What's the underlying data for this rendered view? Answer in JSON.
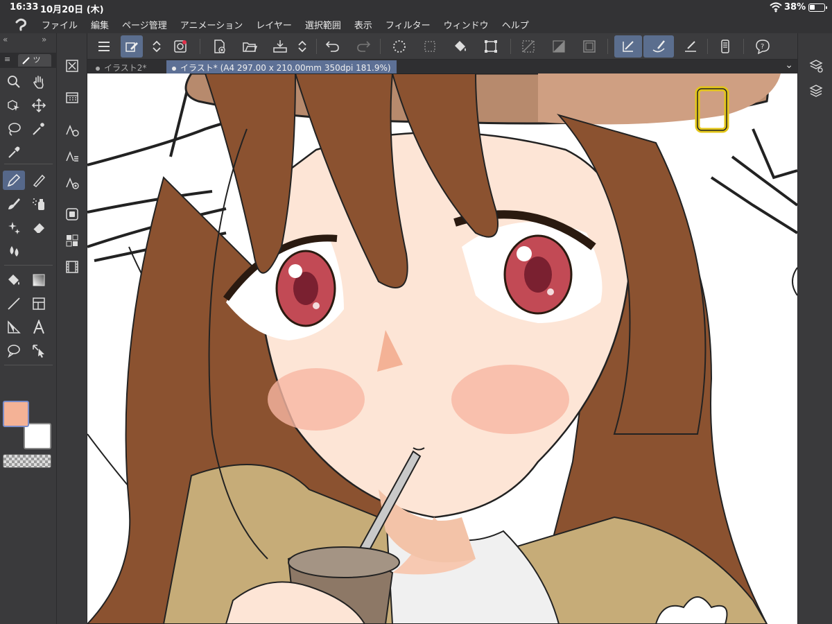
{
  "status": {
    "time": "16:33",
    "date": "10月20日 (木)",
    "battery_pct": "38%",
    "battery_level": 0.38
  },
  "menu": {
    "items": [
      "ファイル",
      "編集",
      "ページ管理",
      "アニメーション",
      "レイヤー",
      "選択範囲",
      "表示",
      "フィルター",
      "ウィンドウ",
      "ヘルプ"
    ]
  },
  "tool_panel": {
    "tab_label": "ツ"
  },
  "doc_tabs": {
    "tab1": "イラスト2*",
    "tab2": "イラスト* (A4 297.00 x 210.00mm 350dpi 181.9%)"
  },
  "colors": {
    "main": "#f4b296",
    "sub": "#ffffff",
    "accent": "#5b6e8e"
  },
  "icons": {
    "toolbar": [
      "menu-icon",
      "edit-mode-icon",
      "stepper-icon",
      "brush-stabilization-icon",
      "new-file-icon",
      "open-file-icon",
      "save-icon",
      "undo-icon",
      "redo-icon",
      "select-all-icon",
      "deselect-icon",
      "fill-icon",
      "transform-icon",
      "snap-icon",
      "snap-ruler-icon",
      "snap-special-icon",
      "pen-pressure-icon",
      "stroke-icon",
      "smoothing-icon",
      "device-icon",
      "help-icon"
    ],
    "tools": [
      "zoom-icon",
      "hand-icon",
      "object-select-icon",
      "move-icon",
      "lasso-icon",
      "magic-wand-icon",
      "eyedropper-icon",
      "pen-icon",
      "pencil-icon",
      "brush-icon",
      "airbrush-icon",
      "decoration-icon",
      "eraser-icon",
      "blend-icon",
      "fill-tool-icon",
      "gradient-icon",
      "line-icon",
      "frame-icon",
      "ruler-icon",
      "text-icon",
      "balloon-icon",
      "correct-line-icon"
    ]
  }
}
